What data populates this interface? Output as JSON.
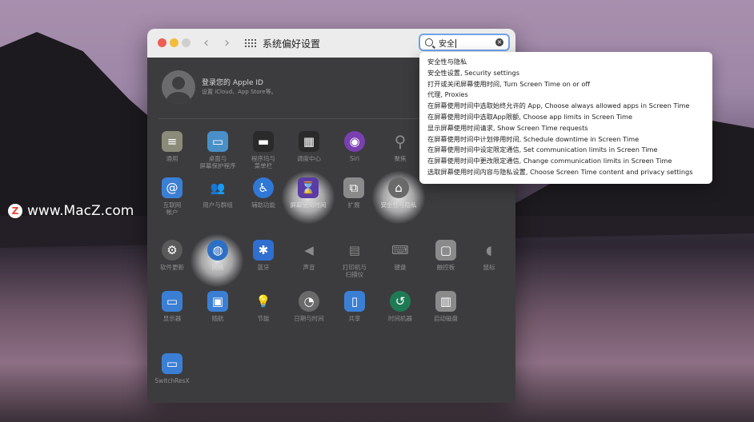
{
  "watermark": {
    "logo": "Z",
    "text": "www.MacZ.com"
  },
  "window": {
    "title": "系统偏好设置",
    "nav_back": "‹",
    "nav_forward": "›"
  },
  "search": {
    "value": "安全",
    "clear": "×"
  },
  "account": {
    "name": "登录您的 Apple ID",
    "subtitle": "设置 iCloud、App Store等。"
  },
  "suggestions": [
    "安全性与隐私",
    "安全性设置, Security settings",
    "打开或关闭屏幕使用时间, Turn Screen Time on or off",
    "代理, Proxies",
    "在屏幕使用时间中选取始终允许的 App, Choose always allowed apps in Screen Time",
    "在屏幕使用时间中选取App限额, Choose app limits in Screen Time",
    "显示屏幕使用时间请求, Show Screen Time requests",
    "在屏幕使用时间中计划停用时间, Schedule downtime in Screen Time",
    "在屏幕使用时间中设定限定通信, Set communication limits in Screen Time",
    "在屏幕使用时间中更改限定通信, Change communication limits in Screen Time",
    "选取屏幕使用时间内容与隐私设置, Choose Screen Time content and privacy settings"
  ],
  "prefs": {
    "general": {
      "label": "通用",
      "icon": "≡",
      "color": "#8b8b7a"
    },
    "desktop": {
      "label": "桌面与\n屏幕保护程序",
      "icon": "▭",
      "color": "#4a90c8"
    },
    "dock": {
      "label": "程序坞与\n菜单栏",
      "icon": "▬",
      "color": "#2a2a2a"
    },
    "mission": {
      "label": "调度中心",
      "icon": "▦",
      "color": "#2a2a2a"
    },
    "siri": {
      "label": "Siri",
      "icon": "◉",
      "color": "#7a3fb0"
    },
    "spotlight": {
      "label": "聚焦",
      "icon": "⚲",
      "color": "#6a6a6a"
    },
    "internet": {
      "label": "互联网\n帐户",
      "icon": "@",
      "color": "#3b7fd4"
    },
    "users": {
      "label": "用户与群组",
      "icon": "👥",
      "color": "#6a6a6a"
    },
    "accessibility": {
      "label": "辅助功能",
      "icon": "♿",
      "color": "#2f78d6"
    },
    "screentime": {
      "label": "屏幕使用时间",
      "icon": "⌛",
      "color": "#5b3ba6"
    },
    "extensions": {
      "label": "扩展",
      "icon": "⧉",
      "color": "#8a8a8a"
    },
    "security": {
      "label": "安全性与隐私",
      "icon": "⌂",
      "color": "#6a6a6a"
    },
    "update": {
      "label": "软件更新",
      "icon": "⚙",
      "color": "#5a5a5a"
    },
    "network": {
      "label": "网络",
      "icon": "◍",
      "color": "#2d6fc4"
    },
    "bluetooth": {
      "label": "蓝牙",
      "icon": "✱",
      "color": "#2f6fd0"
    },
    "sound": {
      "label": "声音",
      "icon": "◀",
      "color": "#6a6a6a"
    },
    "printers": {
      "label": "打印机与\n扫描仪",
      "icon": "▤",
      "color": "#6a6a6a"
    },
    "keyboard": {
      "label": "键盘",
      "icon": "⌨",
      "color": "#8a8a8a"
    },
    "trackpad": {
      "label": "触控板",
      "icon": "▢",
      "color": "#8a8a8a"
    },
    "mouse": {
      "label": "鼠标",
      "icon": "◖",
      "color": "#8a8a8a"
    },
    "displays": {
      "label": "显示器",
      "icon": "▭",
      "color": "#3b7fd4"
    },
    "sidecar": {
      "label": "随航",
      "icon": "▣",
      "color": "#3b7fd4"
    },
    "energy": {
      "label": "节能",
      "icon": "💡",
      "color": "#6a6a6a"
    },
    "datetime": {
      "label": "日期与时间",
      "icon": "◔",
      "color": "#6a6a6a"
    },
    "sharing": {
      "label": "共享",
      "icon": "▯",
      "color": "#3b7fd4"
    },
    "timemachine": {
      "label": "时间机器",
      "icon": "↺",
      "color": "#1e7a55"
    },
    "startup": {
      "label": "启动磁盘",
      "icon": "▥",
      "color": "#8a8a8a"
    },
    "switchresx": {
      "label": "SwitchResX",
      "icon": "▭",
      "color": "#3b7fd4"
    }
  }
}
